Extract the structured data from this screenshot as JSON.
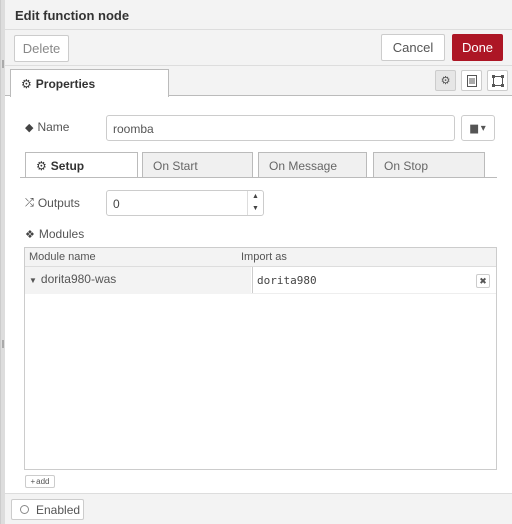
{
  "window": {
    "title": "Edit function node"
  },
  "toolbar": {
    "delete_label": "Delete",
    "cancel_label": "Cancel",
    "done_label": "Done"
  },
  "tabs": {
    "properties_label": "Properties",
    "icons": [
      "gear-icon",
      "description-icon",
      "appearance-icon"
    ]
  },
  "form": {
    "name_label": "Name",
    "name_value": "roomba",
    "subtabs": [
      "Setup",
      "On Start",
      "On Message",
      "On Stop"
    ],
    "outputs_label": "Outputs",
    "outputs_value": "0",
    "modules_label": "Modules"
  },
  "modules": {
    "col_name": "Module name",
    "col_import": "Import as",
    "rows": [
      {
        "name": "dorita980-was",
        "import_as": "dorita980"
      }
    ],
    "add_label": "add"
  },
  "footer": {
    "enabled_label": "Enabled"
  },
  "colors": {
    "done_button": "#ad1625"
  }
}
